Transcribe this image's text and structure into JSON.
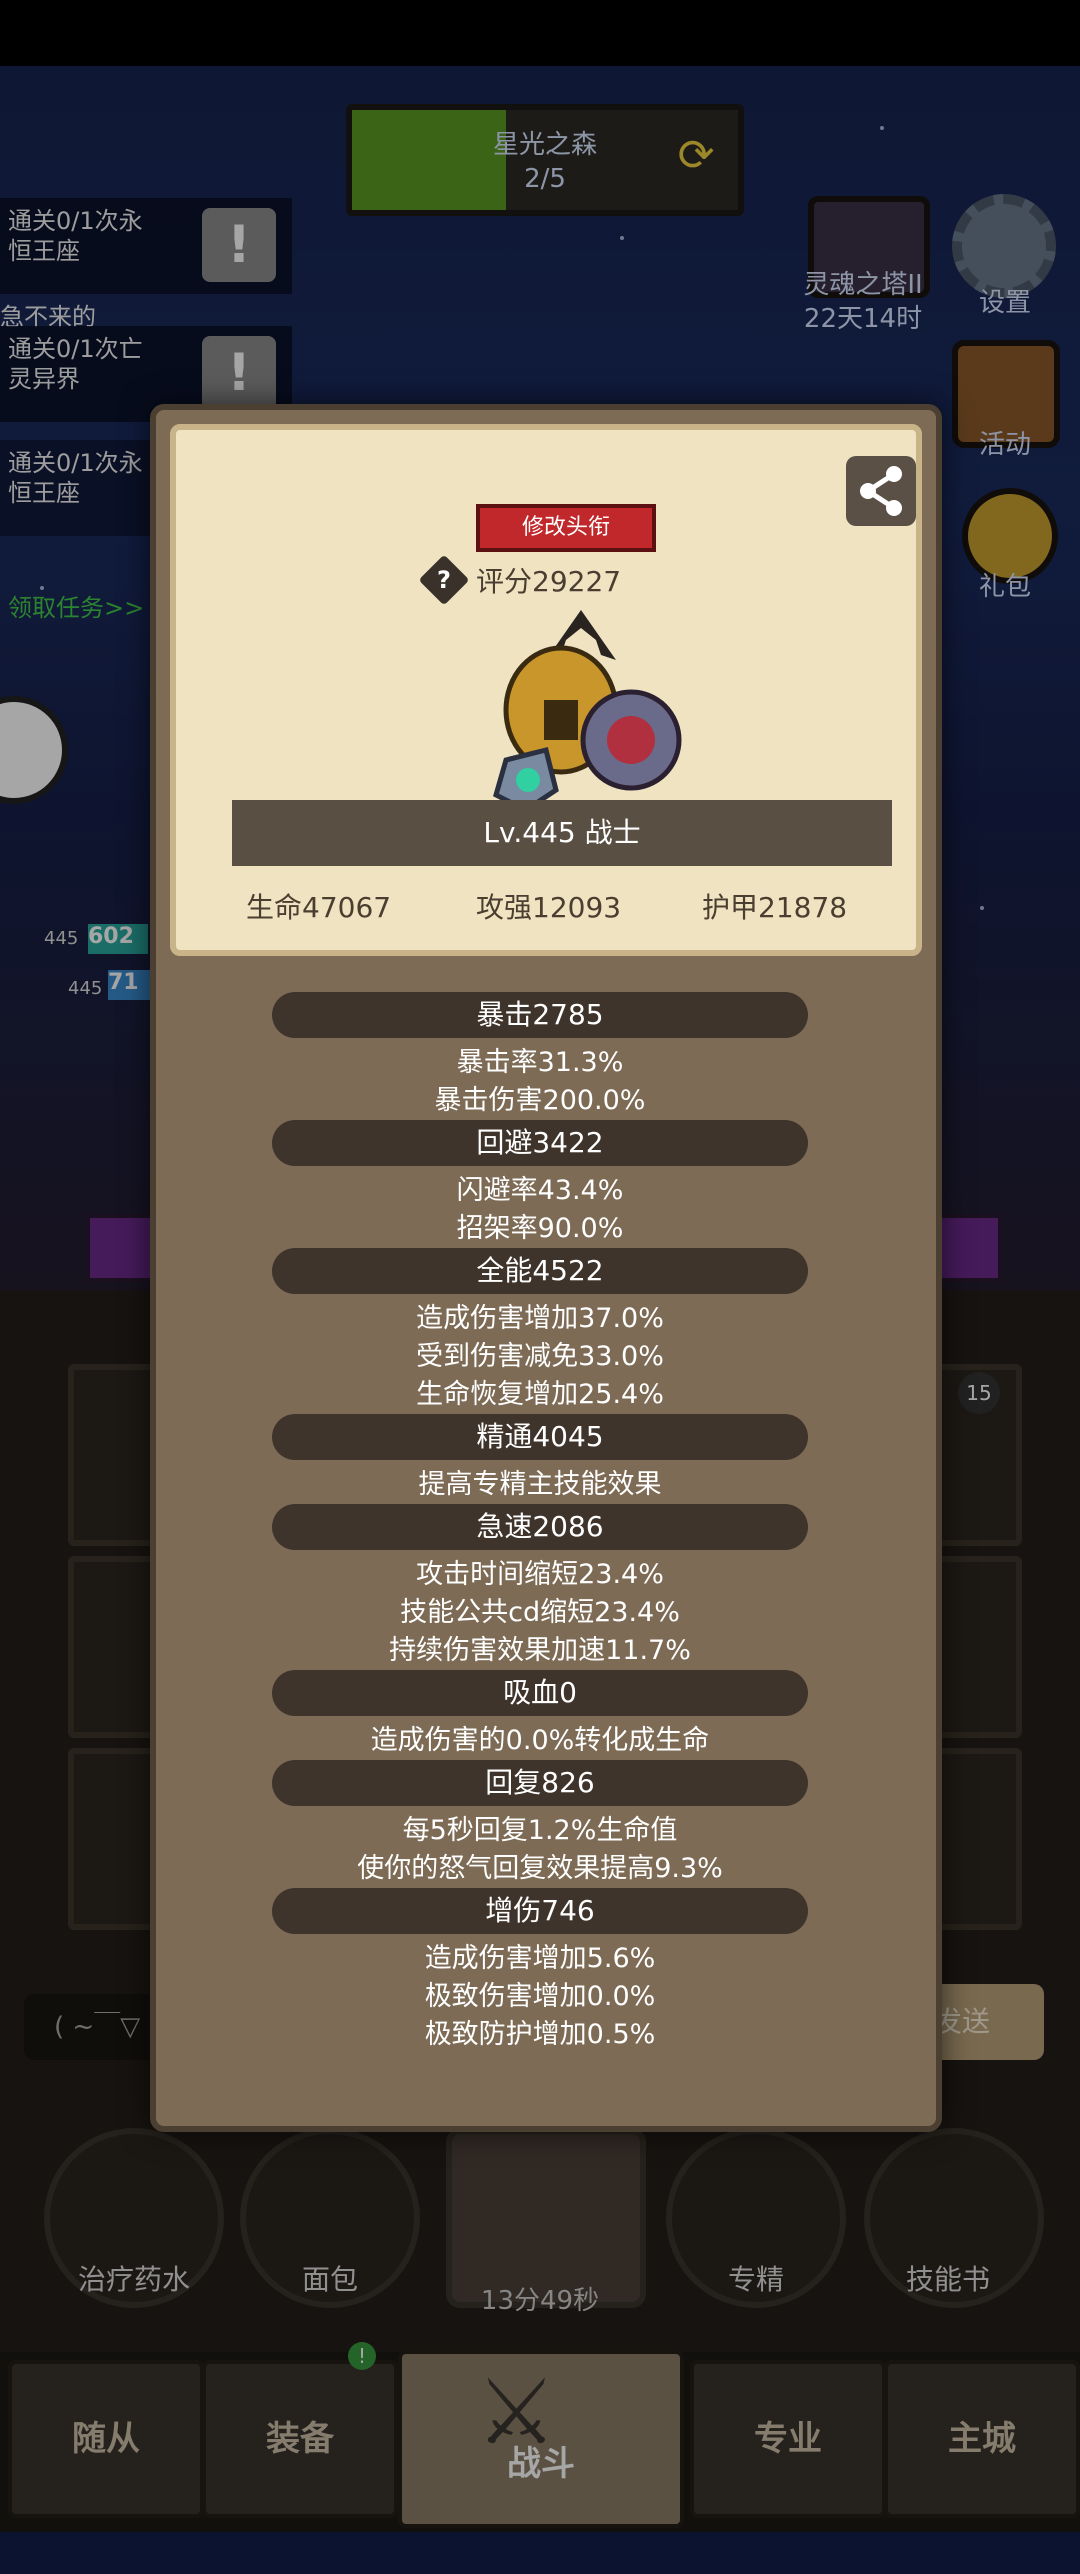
{
  "stage": {
    "name": "星光之森",
    "progress": "2/5",
    "progress_fraction": 0.4
  },
  "quests": [
    {
      "line1": "通关0/1次永",
      "line2": "恒王座"
    },
    {
      "line1": "急不来的",
      "line2": ""
    },
    {
      "line1": "通关0/1次亡",
      "line2": "灵异界"
    },
    {
      "line1": "通关0/1次永",
      "line2": "恒王座"
    }
  ],
  "quest_claim": "领取任务>>",
  "quest_mark": "!",
  "side": {
    "tower_name": "灵魂之塔II",
    "tower_time": "22天14时",
    "settings": "设置",
    "activity": "活动",
    "gift": "礼包"
  },
  "hud": {
    "level_a": "445",
    "hp_a": "602",
    "level_b": "445",
    "hp_b": "71"
  },
  "bag": {
    "badge": "15",
    "input_placeholder": "( ~￣▽",
    "send": "发送"
  },
  "bottom_items": [
    {
      "label": "治疗药水"
    },
    {
      "label": "面包"
    },
    {
      "label": "13分49秒"
    },
    {
      "label": "专精"
    },
    {
      "label": "技能书"
    }
  ],
  "nav": [
    {
      "label": "随从"
    },
    {
      "label": "装备"
    },
    {
      "label": "战斗"
    },
    {
      "label": "专业"
    },
    {
      "label": "主城"
    }
  ],
  "profile": {
    "title_button": "修改头衔",
    "score": "评分29227",
    "help": "?",
    "level_class": "Lv.445 战士",
    "hp": "生命47067",
    "attack": "攻强12093",
    "armor": "护甲21878"
  },
  "stats": [
    {
      "head": "暴击2785",
      "lines": [
        "暴击率31.3%",
        "暴击伤害200.0%"
      ]
    },
    {
      "head": "回避3422",
      "lines": [
        "闪避率43.4%",
        "招架率90.0%"
      ]
    },
    {
      "head": "全能4522",
      "lines": [
        "造成伤害增加37.0%",
        "受到伤害减免33.0%",
        "生命恢复增加25.4%"
      ]
    },
    {
      "head": "精通4045",
      "lines": [
        "提高专精主技能效果"
      ]
    },
    {
      "head": "急速2086",
      "lines": [
        "攻击时间缩短23.4%",
        "技能公共cd缩短23.4%",
        "持续伤害效果加速11.7%"
      ]
    },
    {
      "head": "吸血0",
      "lines": [
        "造成伤害的0.0%转化成生命"
      ]
    },
    {
      "head": "回复826",
      "lines": [
        "每5秒回复1.2%生命值",
        "使你的怒气回复效果提高9.3%"
      ]
    },
    {
      "head": "增伤746",
      "lines": [
        "造成伤害增加5.6%",
        "极致伤害增加0.0%",
        "极致防护增加0.5%"
      ]
    }
  ]
}
